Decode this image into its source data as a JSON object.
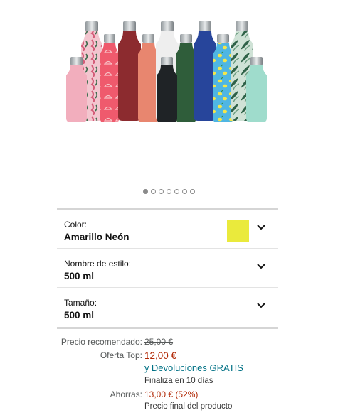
{
  "colors": {
    "swatch": "#eaea3c",
    "price_red": "#b12704",
    "link": "#007185"
  },
  "gallery": {
    "total_images": 7,
    "active_index": 0
  },
  "variants": [
    {
      "label": "Color:",
      "value": "Amarillo Neón",
      "has_swatch": true
    },
    {
      "label": "Nombre de estilo:",
      "value": "500 ml",
      "has_swatch": false
    },
    {
      "label": "Tamaño:",
      "value": "500 ml",
      "has_swatch": false
    }
  ],
  "pricing": {
    "list_label": "Precio recomendado:",
    "list_price": "25,00 €",
    "deal_label": "Oferta Top:",
    "deal_price": "12,00 €",
    "returns_prefix": "y",
    "returns_link": "Devoluciones GRATIS",
    "ends_text": "Finaliza en 10 días",
    "savings_label": "Ahorras:",
    "savings_value": "13,00 € (52%)",
    "final_note": "Precio final del producto"
  }
}
